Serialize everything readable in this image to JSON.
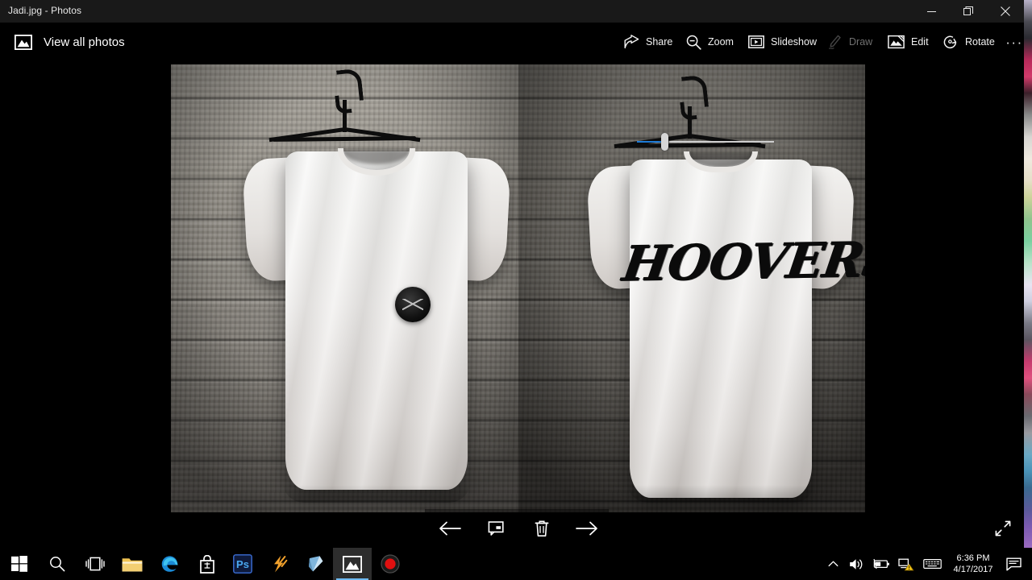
{
  "window": {
    "title": "Jadi.jpg - Photos",
    "controls": {
      "minimize": "Minimize",
      "maximize": "Restore",
      "close": "Close"
    }
  },
  "commandbar": {
    "view_all": "View all photos",
    "tools": [
      {
        "id": "share",
        "label": "Share",
        "icon": "share-icon",
        "disabled": false
      },
      {
        "id": "zoom",
        "label": "Zoom",
        "icon": "magnifier-minus-icon",
        "disabled": false
      },
      {
        "id": "slideshow",
        "label": "Slideshow",
        "icon": "slideshow-icon",
        "disabled": false
      },
      {
        "id": "draw",
        "label": "Draw",
        "icon": "pen-icon",
        "disabled": true
      },
      {
        "id": "edit",
        "label": "Edit",
        "icon": "edit-image-icon",
        "disabled": false
      },
      {
        "id": "rotate",
        "label": "Rotate",
        "icon": "rotate-icon",
        "disabled": false
      }
    ],
    "more_label": "···"
  },
  "zoom_slider": {
    "fill_color": "#1e7bd6",
    "track_color": "#cfcfcf",
    "value_percent": 18
  },
  "photo": {
    "filename": "Jadi.jpg",
    "description": "Two white t-shirts on black hangers against a grey wooden plank wall",
    "left_panel": {
      "view": "front",
      "logo": "circular-black-patch"
    },
    "right_panel": {
      "view": "back",
      "print_text": "HOOVERS"
    }
  },
  "bottom_toolbar": {
    "buttons": [
      {
        "id": "previous",
        "icon": "arrow-left-icon",
        "label": "Previous"
      },
      {
        "id": "annotate",
        "icon": "comment-icon",
        "label": "Add a comment"
      },
      {
        "id": "delete",
        "icon": "trash-icon",
        "label": "Delete"
      },
      {
        "id": "next",
        "icon": "arrow-right-icon",
        "label": "Next"
      }
    ],
    "fullscreen": {
      "icon": "expand-icon",
      "label": "Fullscreen"
    }
  },
  "taskbar": {
    "items": [
      {
        "id": "start",
        "name": "start-button",
        "label": "Start"
      },
      {
        "id": "search",
        "name": "search-icon",
        "label": "Search"
      },
      {
        "id": "taskview",
        "name": "task-view-icon",
        "label": "Task View"
      },
      {
        "id": "explorer",
        "name": "file-explorer-icon",
        "label": "File Explorer"
      },
      {
        "id": "edge",
        "name": "edge-icon",
        "label": "Microsoft Edge"
      },
      {
        "id": "store",
        "name": "store-icon",
        "label": "Microsoft Store"
      },
      {
        "id": "ps",
        "name": "photoshop-icon",
        "label": "Ps"
      },
      {
        "id": "flash",
        "name": "flash-icon",
        "label": "Flash"
      },
      {
        "id": "blue",
        "name": "blue-app-icon",
        "label": "App"
      },
      {
        "id": "photos",
        "name": "photos-icon",
        "label": "Photos",
        "active": true
      },
      {
        "id": "record",
        "name": "record-icon",
        "label": "Record"
      }
    ],
    "tray": {
      "chevron": "show-hidden-icons",
      "volume": "volume-icon",
      "battery": "battery-icon",
      "network": "network-warning-icon",
      "keyboard": "keyboard-icon",
      "time": "6:36 PM",
      "date": "4/17/2017",
      "action_center": "action-center-icon"
    }
  },
  "colors": {
    "accent_blue": "#1e7bd6",
    "taskbar_active_underline": "#6eb9f0",
    "titlebar_bg": "#191919",
    "window_bg": "#000000"
  }
}
